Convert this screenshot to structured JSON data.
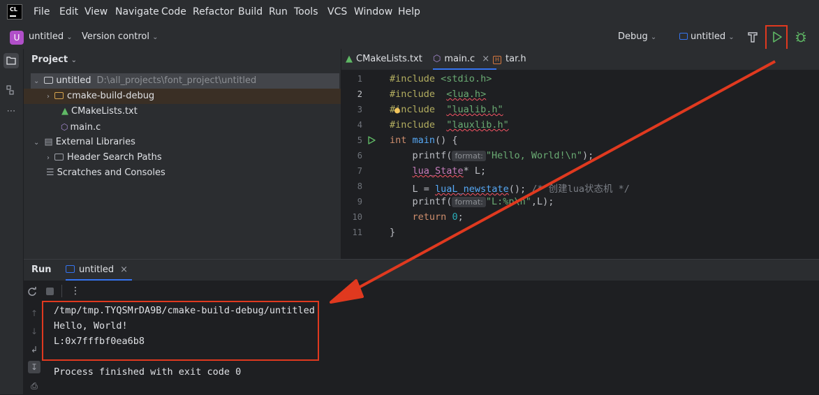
{
  "menubar": {
    "logo": "CL",
    "items": [
      "File",
      "Edit",
      "View",
      "Navigate",
      "Code",
      "Refactor",
      "Build",
      "Run",
      "Tools",
      "VCS",
      "Window",
      "Help"
    ]
  },
  "toolbar": {
    "project_badge": "U",
    "project_name": "untitled",
    "vcs": "Version control",
    "build_config": "Debug",
    "run_config": "untitled"
  },
  "project_panel": {
    "title": "Project",
    "tree": [
      {
        "label": "untitled",
        "hint": "D:\\all_projects\\font_project\\untitled"
      },
      {
        "label": "cmake-build-debug"
      },
      {
        "label": "CMakeLists.txt"
      },
      {
        "label": "main.c"
      },
      {
        "label": "External Libraries"
      },
      {
        "label": "Header Search Paths"
      },
      {
        "label": "Scratches and Consoles"
      }
    ]
  },
  "editor": {
    "tabs": [
      "CMakeLists.txt",
      "main.c",
      "tar.h"
    ],
    "active_tab": "main.c",
    "line_numbers": [
      "1",
      "2",
      "3",
      "4",
      "5",
      "6",
      "7",
      "8",
      "9",
      "10",
      "11"
    ],
    "code": {
      "l1_dir": "#include",
      "l1_arg": "<stdio.h>",
      "l2_dir": "#include",
      "l2_arg": "<lua.h>",
      "l3_dir": "#include",
      "l3_arg": "\"lualib.h\"",
      "l4_dir": "#include",
      "l4_arg": "\"lauxlib.h\"",
      "l5_type": "int",
      "l5_fn": "main",
      "l5_rest": "() {",
      "l6_fn": "printf",
      "l6_hint": "format:",
      "l6_str": "\"Hello, World!\\n\"",
      "l6_end": ");",
      "l7_type": "lua_State",
      "l7_rest": "* L;",
      "l8_lhs": "L = ",
      "l8_fn": "luaL_newstate",
      "l8_rest": "(); ",
      "l8_cmt": "/* 创建lua状态机 */",
      "l9_fn": "printf",
      "l9_hint": "format:",
      "l9_str": "\"L:%p\\n\"",
      "l9_end": ",L);",
      "l10_kw": "return",
      "l10_num": "0",
      "l10_end": ";",
      "l11": "}"
    }
  },
  "run_panel": {
    "title": "Run",
    "tab": "untitled",
    "output": [
      "/tmp/tmp.TYQSMrDA9B/cmake-build-debug/untitled",
      "Hello, World!",
      "L:0x7fffbf0ea6b8"
    ],
    "exit_message": "Process finished with exit code 0"
  },
  "colors": {
    "accent": "#3574f0",
    "annotation": "#e0391f",
    "run_green": "#5fb865"
  }
}
